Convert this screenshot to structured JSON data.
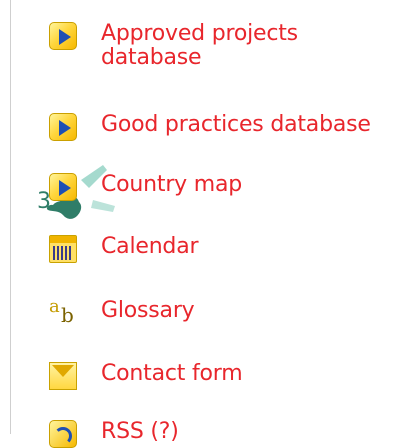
{
  "menu": {
    "items": [
      {
        "label": "Approved projects database",
        "icon": "arrow-right-icon"
      },
      {
        "label": "Good practices database",
        "icon": "arrow-right-icon"
      },
      {
        "label": "Country map",
        "icon": "arrow-right-icon"
      },
      {
        "label": "Calendar",
        "icon": "calendar-icon"
      },
      {
        "label": "Glossary",
        "icon": "glossary-icon"
      },
      {
        "label": "Contact form",
        "icon": "mail-icon"
      },
      {
        "label": "RSS (?)",
        "icon": "rss-icon"
      }
    ]
  },
  "colors": {
    "link": "#e8262c",
    "icon_yellow": "#ffd740",
    "arrow_blue": "#1e4fb3"
  }
}
